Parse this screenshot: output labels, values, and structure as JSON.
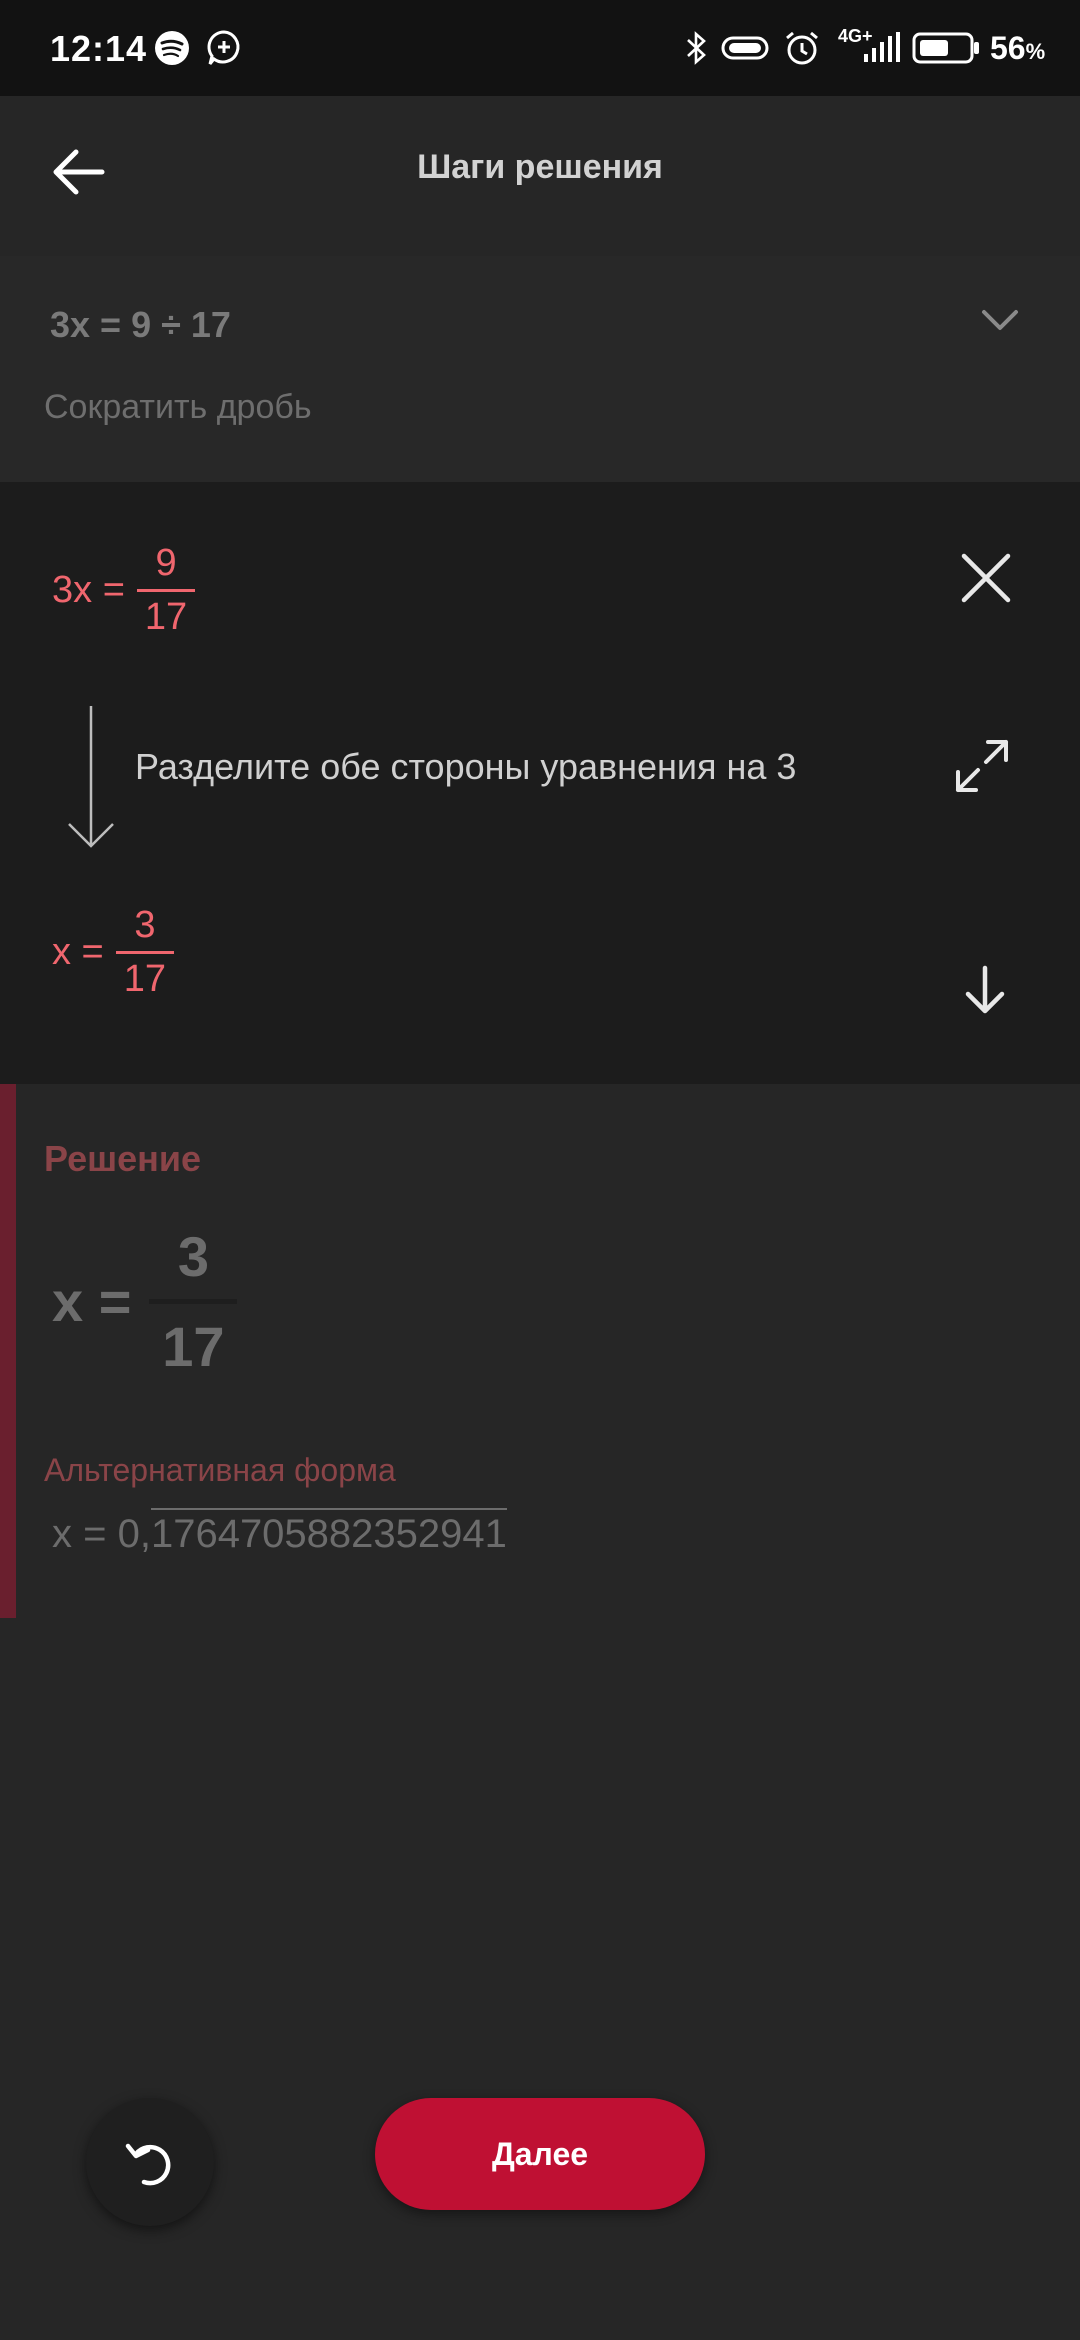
{
  "status_bar": {
    "time": "12:14",
    "network": "4G+",
    "battery_percent": "56",
    "battery_unit": "%",
    "icons": [
      "spotify-icon",
      "messenger-icon",
      "bluetooth-icon",
      "data-saver-icon",
      "alarm-icon",
      "signal-icon",
      "battery-icon"
    ]
  },
  "header": {
    "title": "Шаги решения"
  },
  "step_card": {
    "equation": "3x = 9 ÷ 17",
    "description": "Сократить дробь"
  },
  "panel": {
    "from_lhs": "3x =",
    "from_num": "9",
    "from_den": "17",
    "instruction": "Разделите обе стороны уравнения на 3",
    "to_lhs": "x =",
    "to_num": "3",
    "to_den": "17"
  },
  "solution": {
    "title": "Решение",
    "lhs": "x =",
    "num": "3",
    "den": "17",
    "alt_label": "Альтернативная форма",
    "alt_prefix": "x = 0,",
    "alt_repeating": "1764705882352941"
  },
  "buttons": {
    "next_label": "Далее"
  },
  "colors": {
    "accent": "#bf1033",
    "highlight": "#f0666e",
    "solution_bar": "#6a1f2e"
  }
}
